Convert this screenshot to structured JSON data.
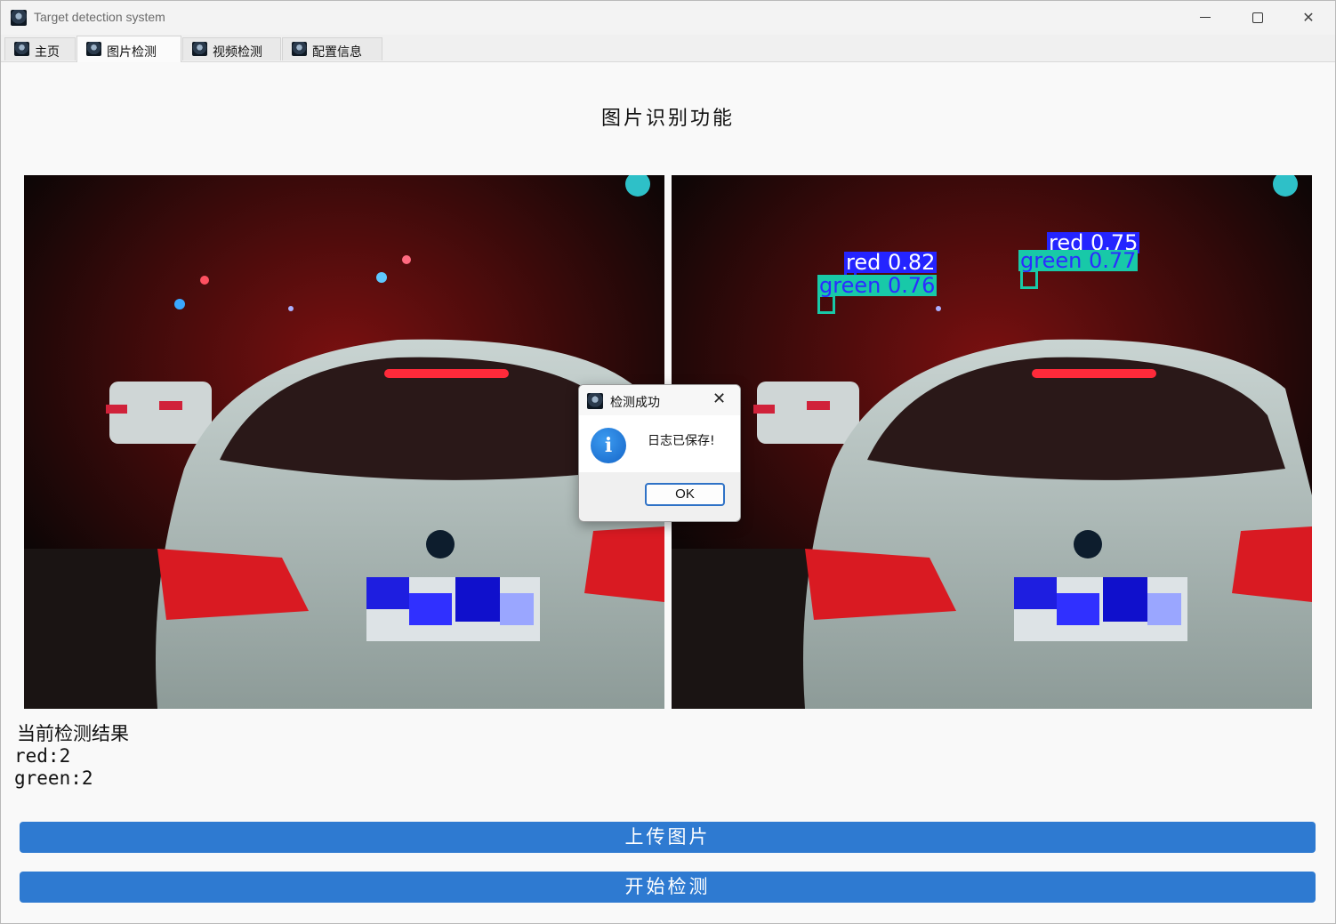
{
  "window": {
    "title": "Target detection system",
    "controls": {
      "minimize": "minimize",
      "maximize": "maximize",
      "close": "close"
    }
  },
  "tabs": [
    {
      "label": "主页",
      "icon": "app-icon",
      "active": false
    },
    {
      "label": "图片检测",
      "icon": "app-icon",
      "active": true
    },
    {
      "label": "视频检测",
      "icon": "app-icon",
      "active": false
    },
    {
      "label": "配置信息",
      "icon": "app-icon",
      "active": false
    }
  ],
  "main": {
    "title": "图片识别功能",
    "detections": [
      {
        "label": "red 0.82",
        "class": "red"
      },
      {
        "label": "green 0.76",
        "class": "green"
      },
      {
        "label": "red 0.75",
        "class": "red"
      },
      {
        "label": "green 0.77",
        "class": "green"
      }
    ],
    "result_heading": "当前检测结果",
    "result_lines": [
      "red:2",
      "green:2"
    ],
    "upload_button": "上传图片",
    "detect_button": "开始检测"
  },
  "dialog": {
    "title": "检测成功",
    "message": "日志已保存!",
    "ok_label": "OK",
    "icon": "info-icon"
  },
  "colors": {
    "button_blue": "#2e7ad1",
    "red_label_bg": "#2424ff",
    "green_label_bg": "#18c9a8"
  }
}
